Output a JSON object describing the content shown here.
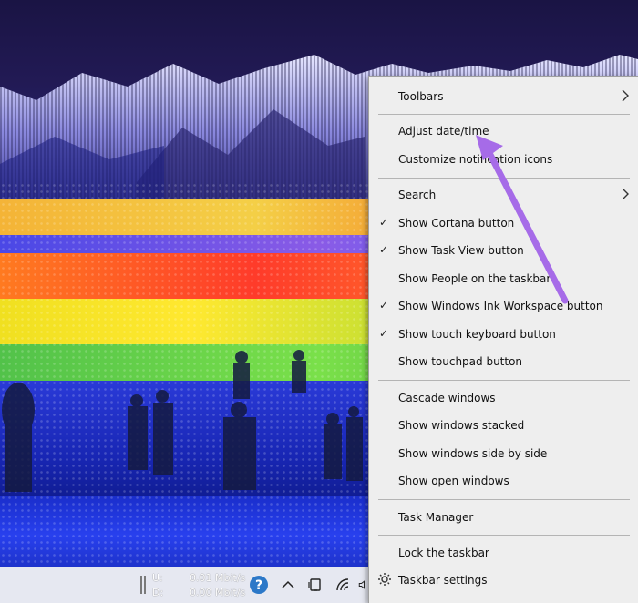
{
  "context_menu": {
    "toolbars": "Toolbars",
    "adjust_datetime": "Adjust date/time",
    "customize_notification_icons": "Customize notification icons",
    "search": "Search",
    "show_cortana_button": "Show Cortana button",
    "show_task_view_button": "Show Task View button",
    "show_people": "Show People on the taskbar",
    "show_ink_workspace": "Show Windows Ink Workspace button",
    "show_touch_keyboard": "Show touch keyboard button",
    "show_touchpad": "Show touchpad button",
    "cascade_windows": "Cascade windows",
    "show_windows_stacked": "Show windows stacked",
    "show_windows_side_by_side": "Show windows side by side",
    "show_open_windows": "Show open windows",
    "task_manager": "Task Manager",
    "lock_taskbar": "Lock the taskbar",
    "taskbar_settings": "Taskbar settings",
    "checked": {
      "show_cortana_button": true,
      "show_task_view_button": true,
      "show_people": false,
      "show_ink_workspace": true,
      "show_touch_keyboard": true,
      "show_touchpad": false
    }
  },
  "taskbar": {
    "upload_label": "U:",
    "upload_value": "0.01 Mbit/s",
    "download_label": "D:",
    "download_value": "0.00 Mbit/s",
    "icons": [
      "help-icon",
      "chevron-up-icon",
      "device-icon",
      "wifi-icon",
      "volume-icon"
    ]
  },
  "colors": {
    "menu_bg": "#eeeeee",
    "taskbar_bg": "#e6e8f1",
    "annotation_arrow": "#a66be8",
    "help_icon": "#2c78c8"
  }
}
